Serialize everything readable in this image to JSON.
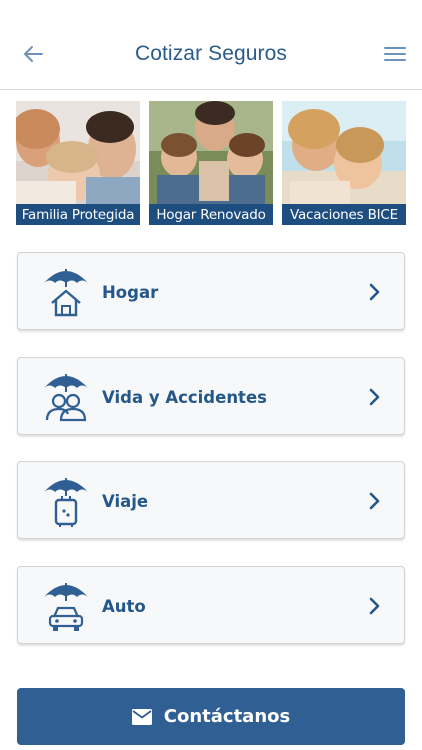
{
  "header": {
    "title": "Cotizar Seguros",
    "back_icon": "arrow-left-icon",
    "menu_icon": "hamburger-menu-icon"
  },
  "banners": [
    {
      "caption": "Familia Protegida"
    },
    {
      "caption": "Hogar Renovado"
    },
    {
      "caption": "Vacaciones BICE"
    }
  ],
  "insurance_options": [
    {
      "label": "Hogar",
      "icon": "umbrella-house-icon"
    },
    {
      "label": "Vida y Accidentes",
      "icon": "umbrella-people-icon"
    },
    {
      "label": "Viaje",
      "icon": "umbrella-suitcase-icon"
    },
    {
      "label": "Auto",
      "icon": "umbrella-car-icon"
    }
  ],
  "contact": {
    "label": "Contáctanos",
    "icon": "envelope-icon"
  },
  "colors": {
    "brand": "#2b5b8c",
    "banner_caption_bg": "#1e4e80",
    "button_bg": "#2f5f93",
    "card_bg": "#f7f8f9"
  }
}
